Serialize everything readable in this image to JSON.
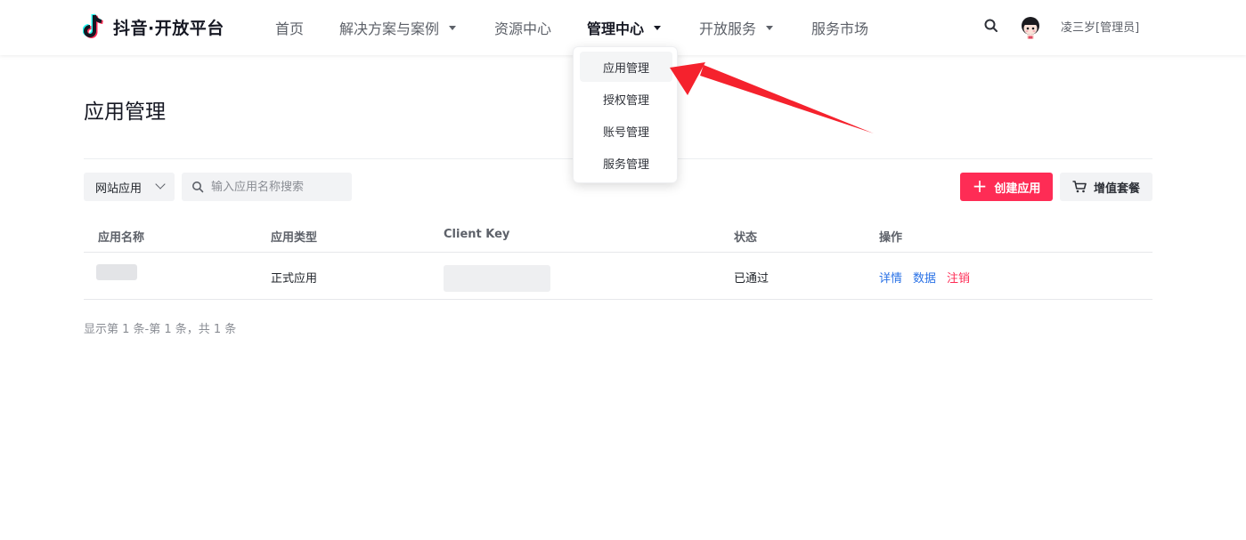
{
  "header": {
    "brand_text": "抖音·开放平台",
    "nav": [
      {
        "label": "首页",
        "has_caret": false,
        "active": false
      },
      {
        "label": "解决方案与案例",
        "has_caret": true,
        "active": false
      },
      {
        "label": "资源中心",
        "has_caret": false,
        "active": false
      },
      {
        "label": "管理中心",
        "has_caret": true,
        "active": true
      },
      {
        "label": "开放服务",
        "has_caret": true,
        "active": false
      },
      {
        "label": "服务市场",
        "has_caret": false,
        "active": false
      }
    ],
    "search_icon": "search-icon",
    "username": "凌三岁[管理员]"
  },
  "dropdown": {
    "items": [
      {
        "label": "应用管理",
        "active": true
      },
      {
        "label": "授权管理",
        "active": false
      },
      {
        "label": "账号管理",
        "active": false
      },
      {
        "label": "服务管理",
        "active": false
      }
    ]
  },
  "annotation": {
    "color": "#f5222d",
    "icon": "red-arrow"
  },
  "page": {
    "title": "应用管理",
    "filter": {
      "selected": "网站应用"
    },
    "search": {
      "placeholder": "输入应用名称搜索",
      "value": ""
    },
    "create_button": "创建应用",
    "package_button": "增值套餐",
    "accent_color": "#fe2c55"
  },
  "table": {
    "columns": [
      "应用名称",
      "应用类型",
      "Client Key",
      "状态",
      "操作"
    ],
    "rows": [
      {
        "name": "",
        "type": "正式应用",
        "client_key": "",
        "status": "已通过",
        "actions": [
          "详情",
          "数据",
          "注销"
        ]
      }
    ]
  },
  "pagination": {
    "summary": "显示第 1 条-第 1 条，共 1 条"
  }
}
